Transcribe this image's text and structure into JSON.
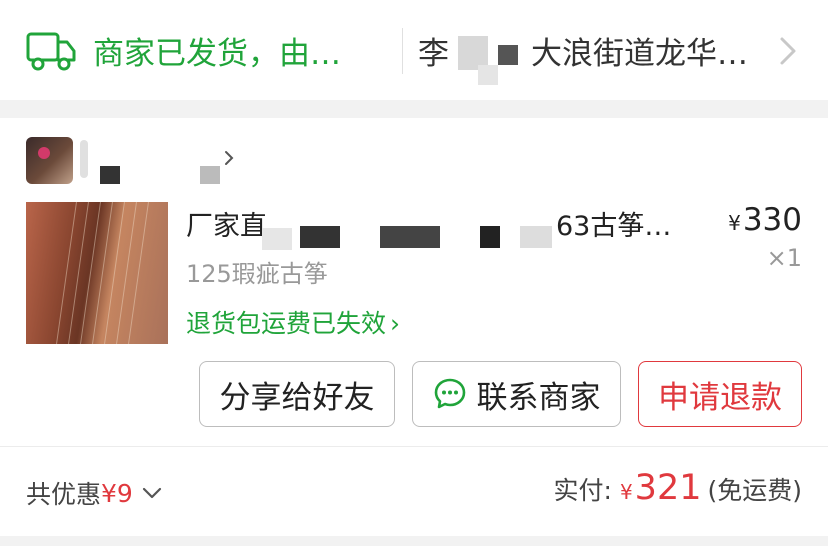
{
  "shipping": {
    "icon": "truck-icon",
    "status_text": "商家已发货，由…",
    "address_text": "李",
    "address_tail": "大浪街道龙华…"
  },
  "store": {
    "avatar": "store-avatar-image"
  },
  "product": {
    "title_head": "厂家直",
    "title_tail": "63古筝…",
    "subtitle": "125瑕疵古筝",
    "return_note": "退货包运费已失效",
    "currency": "¥",
    "price": "330",
    "quantity": "×1"
  },
  "actions": {
    "share_label": "分享给好友",
    "contact_label": "联系商家",
    "refund_label": "申请退款"
  },
  "summary": {
    "discount_label": "共优惠",
    "discount_amount": "¥9",
    "paid_label": "实付:",
    "paid_currency": "¥",
    "paid_amount": "321",
    "paid_note": "(免运费)"
  },
  "colors": {
    "green": "#20a43a",
    "red": "#e0393e"
  }
}
